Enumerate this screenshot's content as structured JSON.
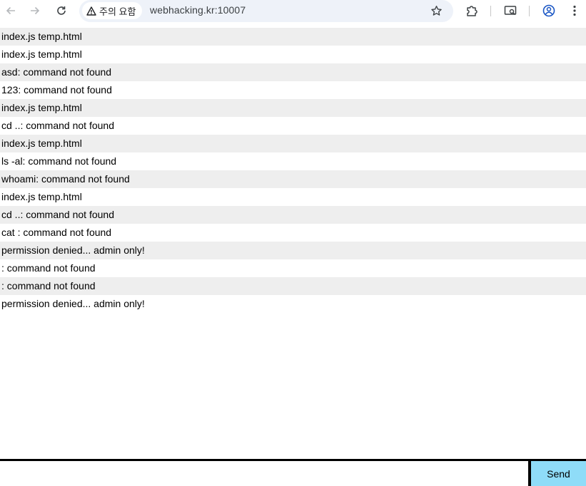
{
  "browser": {
    "security_chip_label": "주의 요함",
    "url": "webhacking.kr:10007",
    "icons": {
      "back": "back-arrow-icon",
      "forward": "forward-arrow-icon",
      "reload": "reload-icon",
      "warning": "warning-triangle-icon",
      "bookmark": "star-icon",
      "extensions": "puzzle-icon",
      "media": "media-icon",
      "profile": "profile-icon",
      "menu": "three-dots-icon"
    }
  },
  "log": {
    "lines": [
      "index.js temp.html",
      "index.js temp.html",
      "asd: command not found",
      "123: command not found",
      "index.js temp.html",
      "cd ..: command not found",
      "index.js temp.html",
      "ls -al: command not found",
      "whoami: command not found",
      "index.js temp.html",
      "cd ..: command not found",
      "cat : command not found",
      "permission denied... admin only!",
      ": command not found",
      ": command not found",
      "permission denied... admin only!"
    ]
  },
  "input": {
    "value": "",
    "send_label": "Send"
  },
  "colors": {
    "row_alt": "#eeeeee",
    "send_button": "#8fdcf8",
    "omnibox": "#eef2f9"
  }
}
